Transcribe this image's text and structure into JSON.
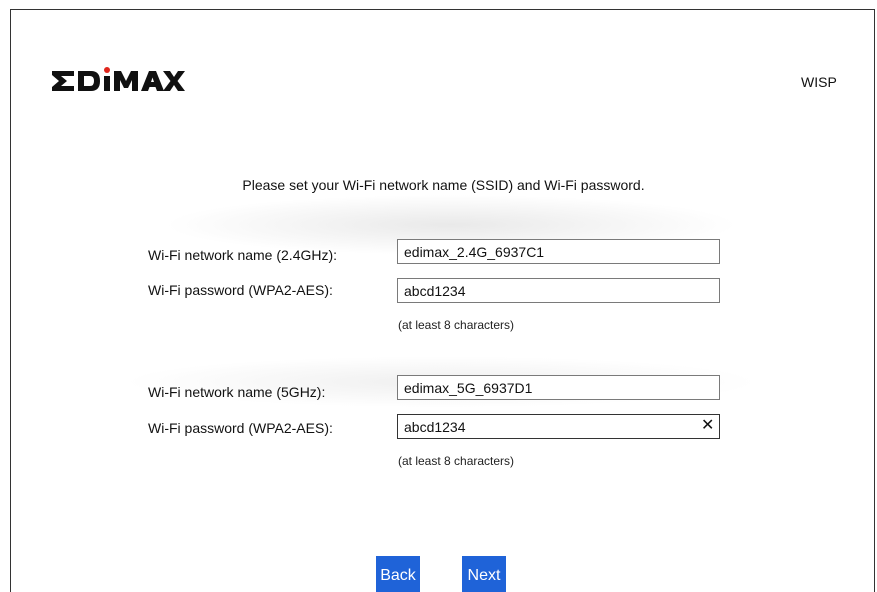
{
  "brand": {
    "logo_text": "EDIMAX"
  },
  "header": {
    "mode": "WISP"
  },
  "instruction": "Please set your Wi-Fi network name (SSID) and Wi-Fi password.",
  "band_24": {
    "ssid_label": "Wi-Fi network name (2.4GHz):",
    "ssid_value": "edimax_2.4G_6937C1",
    "password_label": "Wi-Fi password (WPA2-AES):",
    "password_value": "abcd1234",
    "hint": "(at least 8 characters)"
  },
  "band_5": {
    "ssid_label": "Wi-Fi network name (5GHz):",
    "ssid_value": "edimax_5G_6937D1",
    "password_label": "Wi-Fi password (WPA2-AES):",
    "password_value": "abcd1234",
    "hint": "(at least 8 characters)",
    "clear_glyph": "✕"
  },
  "buttons": {
    "back": "Back",
    "next": "Next"
  },
  "colors": {
    "button_bg": "#1f63d8",
    "logo_dot": "#e0261c"
  }
}
